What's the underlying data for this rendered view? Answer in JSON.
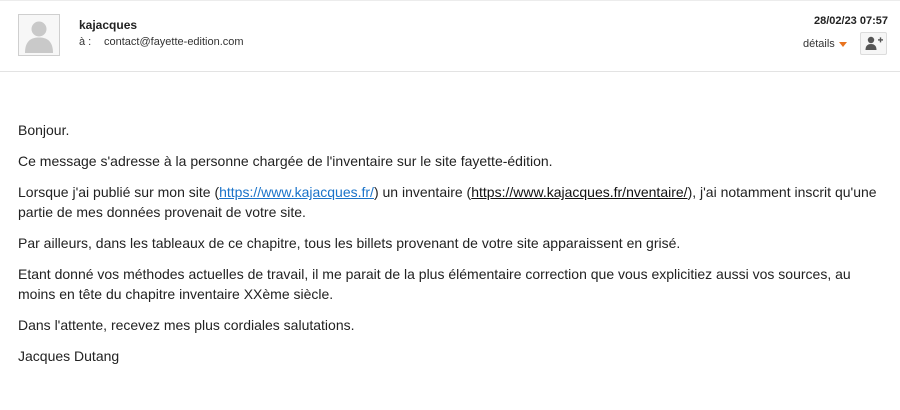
{
  "header": {
    "sender_name": "kajacques",
    "to_label": "à :",
    "to_address": "contact@fayette-edition.com",
    "date": "28/02/23 07:57",
    "details_label": "détails",
    "details_caret_color": "#e8731f",
    "icons": {
      "avatar": "person-avatar-icon",
      "details_caret": "caret-down-icon",
      "add_contact": "add-contact-icon"
    }
  },
  "message": {
    "greeting": "Bonjour.",
    "p1": "Ce message s'adresse à la personne chargée de l'inventaire sur le site fayette-édition.",
    "p2": {
      "before_link1": "Lorsque j'ai publié sur mon site (",
      "link1": "https://www.kajacques.fr/",
      "between": ") un inventaire (",
      "link2": "https://www.kajacques.fr/nventaire/",
      "after_link2": "), j'ai notamment inscrit qu'une partie de mes données provenait de votre site."
    },
    "p3": "Par ailleurs, dans les tableaux de ce chapitre, tous les billets provenant de votre site apparaissent en grisé.",
    "p4": "Etant donné vos méthodes actuelles de travail, il me parait de la plus élémentaire correction que vous explicitiez aussi vos sources, au moins en tête du chapitre inventaire XXème siècle.",
    "p5": "Dans l'attente, recevez mes plus cordiales salutations.",
    "signature": "Jacques Dutang",
    "link_color": "#1a73c9"
  }
}
